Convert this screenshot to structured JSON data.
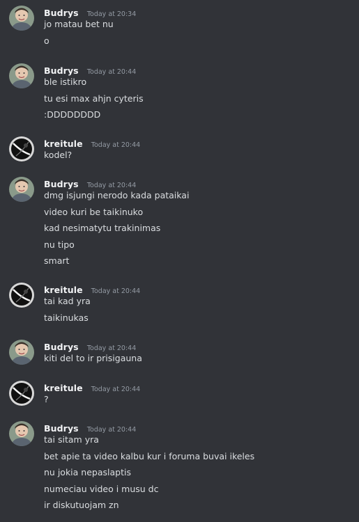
{
  "groups": [
    {
      "author": "Budrys",
      "time": "Today at 20:34",
      "avatar_icon": "user-avatar-photo-icon",
      "lines": [
        "jo matau bet nu",
        "o"
      ]
    },
    {
      "author": "Budrys",
      "time": "Today at 20:44",
      "avatar_icon": "user-avatar-photo-icon",
      "lines": [
        "ble istikro",
        "tu esi max ahjn cyteris",
        ":DDDDDDDD"
      ]
    },
    {
      "author": "kreitule",
      "time": "Today at 20:44",
      "avatar_icon": "user-avatar-dark-icon",
      "lines": [
        "kodel?"
      ]
    },
    {
      "author": "Budrys",
      "time": "Today at 20:44",
      "avatar_icon": "user-avatar-photo-icon",
      "lines": [
        "dmg isjungi nerodo kada pataikai",
        "video kuri be taikinuko",
        "kad nesimatytu trakinimas",
        "nu tipo",
        "smart"
      ]
    },
    {
      "author": "kreitule",
      "time": "Today at 20:44",
      "avatar_icon": "user-avatar-dark-icon",
      "lines": [
        "tai kad yra",
        "taikinukas"
      ]
    },
    {
      "author": "Budrys",
      "time": "Today at 20:44",
      "avatar_icon": "user-avatar-photo-icon",
      "lines": [
        "kiti del to ir prisigauna"
      ]
    },
    {
      "author": "kreitule",
      "time": "Today at 20:44",
      "avatar_icon": "user-avatar-dark-icon",
      "lines": [
        "?"
      ]
    },
    {
      "author": "Budrys",
      "time": "Today at 20:44",
      "avatar_icon": "user-avatar-photo-icon",
      "lines": [
        "tai sitam yra",
        "bet apie ta video kalbu kur i foruma buvai ikeles",
        "nu jokia nepaslaptis",
        "numeciau video i musu dc",
        "ir diskutuojam zn"
      ]
    }
  ],
  "colors": {
    "background": "#313338",
    "author": "#f2f3f5",
    "timestamp": "#949ba4",
    "message": "#dbdee1"
  }
}
